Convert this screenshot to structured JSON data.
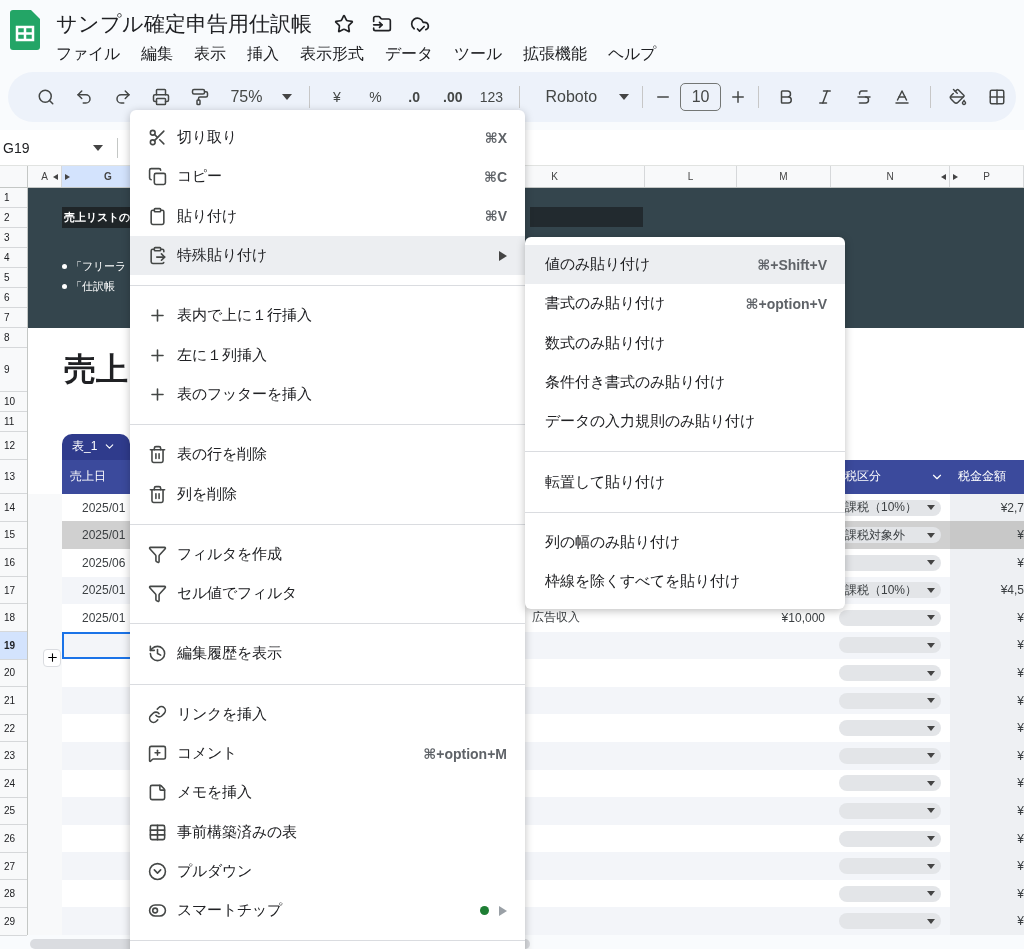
{
  "document": {
    "title": "サンプル確定申告用仕訳帳"
  },
  "menu_bar": [
    "ファイル",
    "編集",
    "表示",
    "挿入",
    "表示形式",
    "データ",
    "ツール",
    "拡張機能",
    "ヘルプ"
  ],
  "toolbar": {
    "zoom": "75%",
    "currency": "¥",
    "percent": "%",
    "decrease_decimals": ".0",
    "increase_decimals": ".00",
    "number_format": "123",
    "font": "Roboto",
    "font_size": "10"
  },
  "name_box": "G19",
  "column_headers": [
    {
      "label": "A",
      "selected": false
    },
    {
      "label": "G",
      "selected": true
    },
    {
      "label": "K",
      "selected": false
    },
    {
      "label": "L",
      "selected": false
    },
    {
      "label": "M",
      "selected": false
    },
    {
      "label": "N",
      "selected": false
    },
    {
      "label": "P",
      "selected": false
    }
  ],
  "row_numbers": [
    {
      "label": "1",
      "selected": false
    },
    {
      "label": "2",
      "selected": false
    },
    {
      "label": "3",
      "selected": false
    },
    {
      "label": "4",
      "selected": false
    },
    {
      "label": "5",
      "selected": false
    },
    {
      "label": "6",
      "selected": false
    },
    {
      "label": "7",
      "selected": false
    },
    {
      "label": "8",
      "selected": false
    },
    {
      "label": "9",
      "selected": false
    },
    {
      "label": "10",
      "selected": false
    },
    {
      "label": "11",
      "selected": false
    },
    {
      "label": "12",
      "selected": false
    },
    {
      "label": "13",
      "selected": false
    },
    {
      "label": "14",
      "selected": false
    },
    {
      "label": "15",
      "selected": false
    },
    {
      "label": "16",
      "selected": false
    },
    {
      "label": "17",
      "selected": false
    },
    {
      "label": "18",
      "selected": false
    },
    {
      "label": "19",
      "selected": true
    },
    {
      "label": "20",
      "selected": false
    },
    {
      "label": "21",
      "selected": false
    },
    {
      "label": "22",
      "selected": false
    },
    {
      "label": "23",
      "selected": false
    },
    {
      "label": "24",
      "selected": false
    },
    {
      "label": "25",
      "selected": false
    },
    {
      "label": "26",
      "selected": false
    },
    {
      "label": "27",
      "selected": false
    },
    {
      "label": "28",
      "selected": false
    },
    {
      "label": "29",
      "selected": false
    }
  ],
  "banner": {
    "heading": "売上リストの",
    "bullets": [
      "「フリーラ",
      "「仕訳帳"
    ]
  },
  "sheet_title": "売上",
  "table": {
    "tab": "表_1",
    "columns": [
      {
        "label": "売上日"
      },
      {
        "label": "税区分"
      },
      {
        "label": "税金金額"
      }
    ],
    "rows": [
      {
        "date": "2025/01",
        "item": "",
        "amount": "",
        "tax_type": "課税（10%）",
        "tax": "¥2,7",
        "shaded": false,
        "selected": false
      },
      {
        "date": "2025/01",
        "item": "",
        "amount": "",
        "tax_type": "課税対象外",
        "tax": "¥",
        "shaded": true,
        "selected": false
      },
      {
        "date": "2025/06",
        "item": "",
        "amount": "",
        "tax_type": "",
        "tax": "¥",
        "shaded": false,
        "selected": false
      },
      {
        "date": "2025/01",
        "item": "",
        "amount": "",
        "tax_type": "課税（10%）",
        "tax": "¥4,5",
        "shaded": false,
        "selected": false
      },
      {
        "date": "2025/01",
        "item": "広告収入",
        "amount": "¥10,000",
        "tax_type": "",
        "tax": "¥",
        "shaded": false,
        "selected": false
      },
      {
        "date": "",
        "item": "",
        "amount": "",
        "tax_type": "",
        "tax": "¥",
        "shaded": false,
        "selected": true
      },
      {
        "date": "",
        "item": "",
        "amount": "",
        "tax_type": "",
        "tax": "¥",
        "shaded": false,
        "selected": false
      },
      {
        "date": "",
        "item": "",
        "amount": "",
        "tax_type": "",
        "tax": "¥",
        "shaded": false,
        "selected": false
      },
      {
        "date": "",
        "item": "",
        "amount": "",
        "tax_type": "",
        "tax": "¥",
        "shaded": false,
        "selected": false
      },
      {
        "date": "",
        "item": "",
        "amount": "",
        "tax_type": "",
        "tax": "¥",
        "shaded": false,
        "selected": false
      },
      {
        "date": "",
        "item": "",
        "amount": "",
        "tax_type": "",
        "tax": "¥",
        "shaded": false,
        "selected": false
      },
      {
        "date": "",
        "item": "",
        "amount": "",
        "tax_type": "",
        "tax": "¥",
        "shaded": false,
        "selected": false
      },
      {
        "date": "",
        "item": "",
        "amount": "",
        "tax_type": "",
        "tax": "¥",
        "shaded": false,
        "selected": false
      },
      {
        "date": "",
        "item": "",
        "amount": "",
        "tax_type": "",
        "tax": "¥",
        "shaded": false,
        "selected": false
      },
      {
        "date": "",
        "item": "",
        "amount": "",
        "tax_type": "",
        "tax": "¥",
        "shaded": false,
        "selected": false
      },
      {
        "date": "",
        "item": "",
        "amount": "",
        "tax_type": "",
        "tax": "¥",
        "shaded": false,
        "selected": false
      }
    ]
  },
  "context_menu": {
    "items": [
      {
        "kind": "item",
        "label": "切り取り",
        "shortcut": "⌘X",
        "highlighted": false
      },
      {
        "kind": "item",
        "label": "コピー",
        "shortcut": "⌘C",
        "highlighted": false
      },
      {
        "kind": "item",
        "label": "貼り付け",
        "shortcut": "⌘V",
        "highlighted": false
      },
      {
        "kind": "item",
        "label": "特殊貼り付け",
        "highlighted": true,
        "submenu": true
      },
      {
        "kind": "divider"
      },
      {
        "kind": "item",
        "label": "表内で上に１行挿入",
        "highlighted": false
      },
      {
        "kind": "item",
        "label": "左に１列挿入",
        "highlighted": false
      },
      {
        "kind": "item",
        "label": "表のフッターを挿入",
        "highlighted": false
      },
      {
        "kind": "divider"
      },
      {
        "kind": "item",
        "label": "表の行を削除",
        "highlighted": false
      },
      {
        "kind": "item",
        "label": "列を削除",
        "highlighted": false
      },
      {
        "kind": "divider"
      },
      {
        "kind": "item",
        "label": "フィルタを作成",
        "highlighted": false
      },
      {
        "kind": "item",
        "label": "セル値でフィルタ",
        "highlighted": false
      },
      {
        "kind": "divider"
      },
      {
        "kind": "item",
        "label": "編集履歴を表示",
        "highlighted": false
      },
      {
        "kind": "divider"
      },
      {
        "kind": "item",
        "label": "リンクを挿入",
        "highlighted": false
      },
      {
        "kind": "item",
        "label": "コメント",
        "shortcut": "⌘+option+M",
        "highlighted": false
      },
      {
        "kind": "item",
        "label": "メモを挿入",
        "highlighted": false
      },
      {
        "kind": "item",
        "label": "事前構築済みの表",
        "highlighted": false
      },
      {
        "kind": "item",
        "label": "プルダウン",
        "highlighted": false
      },
      {
        "kind": "item",
        "label": "スマートチップ",
        "highlighted": false,
        "submenu": true,
        "dot": true
      },
      {
        "kind": "divider"
      }
    ]
  },
  "submenu": {
    "items": [
      {
        "kind": "item",
        "label": "値のみ貼り付け",
        "shortcut": "⌘+Shift+V",
        "highlighted": true
      },
      {
        "kind": "item",
        "label": "書式のみ貼り付け",
        "shortcut": "⌘+option+V",
        "highlighted": false
      },
      {
        "kind": "item",
        "label": "数式のみ貼り付け",
        "highlighted": false
      },
      {
        "kind": "item",
        "label": "条件付き書式のみ貼り付け",
        "highlighted": false
      },
      {
        "kind": "item",
        "label": "データの入力規則のみ貼り付け",
        "highlighted": false
      },
      {
        "kind": "divider"
      },
      {
        "kind": "item",
        "label": "転置して貼り付け",
        "highlighted": false
      },
      {
        "kind": "divider"
      },
      {
        "kind": "item",
        "label": "列の幅のみ貼り付け",
        "highlighted": false
      },
      {
        "kind": "item",
        "label": "枠線を除くすべてを貼り付け",
        "highlighted": false
      }
    ]
  }
}
